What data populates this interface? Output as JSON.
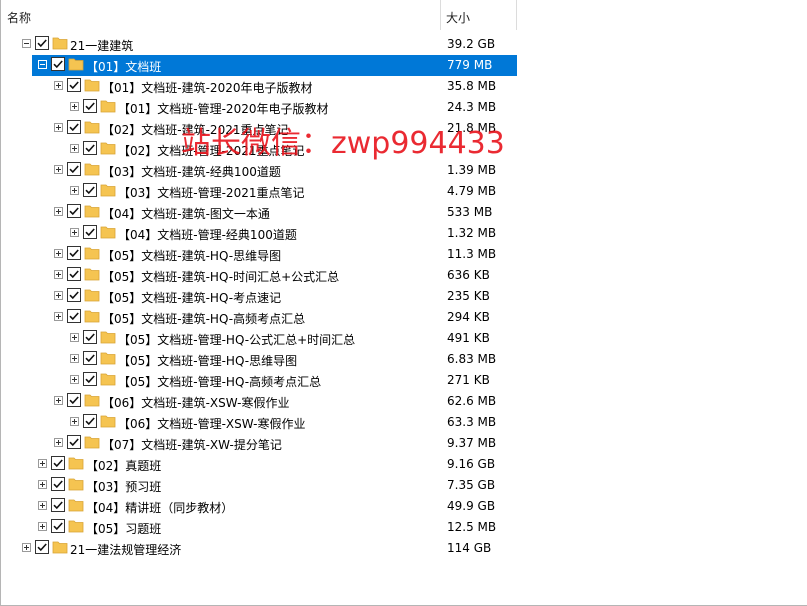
{
  "columns": {
    "name": "名称",
    "size": "大小"
  },
  "watermark": "站长微信：zwp994433",
  "colors": {
    "selection": "#0078d7",
    "folder": "#f5c451",
    "watermark": "#e8141c"
  },
  "items": [
    {
      "label": "21一建建筑",
      "size": "39.2 GB",
      "level": 0,
      "expanded": true,
      "checked": true,
      "selected": false
    },
    {
      "label": "【01】文档班",
      "size": "779 MB",
      "level": 1,
      "expanded": true,
      "checked": true,
      "selected": true
    },
    {
      "label": "【01】文档班-建筑-2020年电子版教材",
      "size": "35.8 MB",
      "level": 2,
      "expanded": false,
      "checked": true,
      "selected": false
    },
    {
      "label": "【01】文档班-管理-2020年电子版教材",
      "size": "24.3 MB",
      "level": 3,
      "expanded": false,
      "checked": true,
      "selected": false
    },
    {
      "label": "【02】文档班-建筑-2021重点笔记",
      "size": "21.8 MB",
      "level": 2,
      "expanded": false,
      "checked": true,
      "selected": false
    },
    {
      "label": "【02】文档班-管理-2021重点笔记",
      "size": "",
      "level": 3,
      "expanded": false,
      "checked": true,
      "selected": false
    },
    {
      "label": "【03】文档班-建筑-经典100道题",
      "size": "1.39 MB",
      "level": 2,
      "expanded": false,
      "checked": true,
      "selected": false
    },
    {
      "label": "【03】文档班-管理-2021重点笔记",
      "size": "4.79 MB",
      "level": 3,
      "expanded": false,
      "checked": true,
      "selected": false
    },
    {
      "label": "【04】文档班-建筑-图文一本通",
      "size": "533 MB",
      "level": 2,
      "expanded": false,
      "checked": true,
      "selected": false
    },
    {
      "label": "【04】文档班-管理-经典100道题",
      "size": "1.32 MB",
      "level": 3,
      "expanded": false,
      "checked": true,
      "selected": false
    },
    {
      "label": "【05】文档班-建筑-HQ-思维导图",
      "size": "11.3 MB",
      "level": 2,
      "expanded": false,
      "checked": true,
      "selected": false
    },
    {
      "label": "【05】文档班-建筑-HQ-时间汇总+公式汇总",
      "size": "636 KB",
      "level": 2,
      "expanded": false,
      "checked": true,
      "selected": false
    },
    {
      "label": "【05】文档班-建筑-HQ-考点速记",
      "size": "235 KB",
      "level": 2,
      "expanded": false,
      "checked": true,
      "selected": false
    },
    {
      "label": "【05】文档班-建筑-HQ-高频考点汇总",
      "size": "294 KB",
      "level": 2,
      "expanded": false,
      "checked": true,
      "selected": false
    },
    {
      "label": "【05】文档班-管理-HQ-公式汇总+时间汇总",
      "size": "491 KB",
      "level": 3,
      "expanded": false,
      "checked": true,
      "selected": false
    },
    {
      "label": "【05】文档班-管理-HQ-思维导图",
      "size": "6.83 MB",
      "level": 3,
      "expanded": false,
      "checked": true,
      "selected": false
    },
    {
      "label": "【05】文档班-管理-HQ-高频考点汇总",
      "size": "271 KB",
      "level": 3,
      "expanded": false,
      "checked": true,
      "selected": false
    },
    {
      "label": "【06】文档班-建筑-XSW-寒假作业",
      "size": "62.6 MB",
      "level": 2,
      "expanded": false,
      "checked": true,
      "selected": false
    },
    {
      "label": "【06】文档班-管理-XSW-寒假作业",
      "size": "63.3 MB",
      "level": 3,
      "expanded": false,
      "checked": true,
      "selected": false
    },
    {
      "label": "【07】文档班-建筑-XW-提分笔记",
      "size": "9.37 MB",
      "level": 2,
      "expanded": false,
      "checked": true,
      "selected": false
    },
    {
      "label": "【02】真题班",
      "size": "9.16 GB",
      "level": 1,
      "expanded": false,
      "checked": true,
      "selected": false
    },
    {
      "label": "【03】预习班",
      "size": "7.35 GB",
      "level": 1,
      "expanded": false,
      "checked": true,
      "selected": false
    },
    {
      "label": "【04】精讲班（同步教材）",
      "size": "49.9 GB",
      "level": 1,
      "expanded": false,
      "checked": true,
      "selected": false
    },
    {
      "label": "【05】习题班",
      "size": "12.5 MB",
      "level": 1,
      "expanded": false,
      "checked": true,
      "selected": false
    },
    {
      "label": "21一建法规管理经济",
      "size": "114 GB",
      "level": 0,
      "expanded": false,
      "checked": true,
      "selected": false
    }
  ]
}
